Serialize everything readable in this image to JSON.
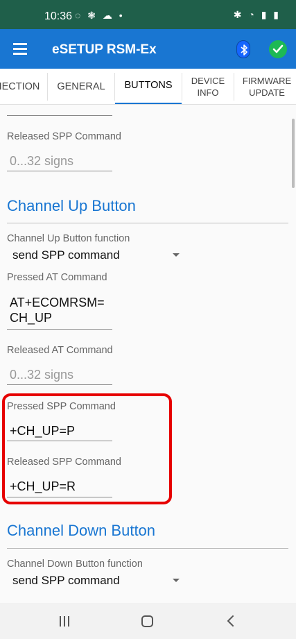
{
  "status_bar": {
    "time": "10:36",
    "left_icons": "◌ ❃ ☁ •",
    "right_icons": "✱ ◔ ▮ ▮"
  },
  "app_bar": {
    "title": "eSETUP RSM-Ex",
    "icons": [
      "menu-icon",
      "bluetooth-icon",
      "check-icon"
    ],
    "colors": {
      "bar": "#1976d2",
      "bluetooth": "#1565ff",
      "ok": "#1db954"
    }
  },
  "tabs": [
    {
      "label": "IECTION"
    },
    {
      "label": "GENERAL"
    },
    {
      "label": "BUTTONS",
      "active": true
    },
    {
      "label": "DEVICE INFO",
      "line1": "DEVICE",
      "line2": "INFO"
    },
    {
      "label": "FIRMWARE UPDATE",
      "line1": "FIRMWARE",
      "line2": "UPDATE"
    }
  ],
  "top_partial": {
    "released_spp_label": "Released SPP Command",
    "released_spp_placeholder": "0...32 signs"
  },
  "channel_up": {
    "title": "Channel Up Button",
    "function_label": "Channel Up Button function",
    "function_value": "send SPP command",
    "pressed_at_label": "Pressed AT Command",
    "pressed_at_line1": "AT+ECOMRSM=",
    "pressed_at_line2": "CH_UP",
    "released_at_label": "Released AT Command",
    "released_at_placeholder": "0...32 signs",
    "pressed_spp_label": "Pressed SPP Command",
    "pressed_spp_value": "+CH_UP=P",
    "released_spp_label": "Released SPP Command",
    "released_spp_value": "+CH_UP=R"
  },
  "channel_down": {
    "title": "Channel Down Button",
    "function_label": "Channel Down Button function",
    "function_value": "send SPP command"
  },
  "highlight_color": "#e60000",
  "nav_bar": {
    "icons": [
      "recent-apps-icon",
      "home-icon",
      "back-icon"
    ]
  }
}
